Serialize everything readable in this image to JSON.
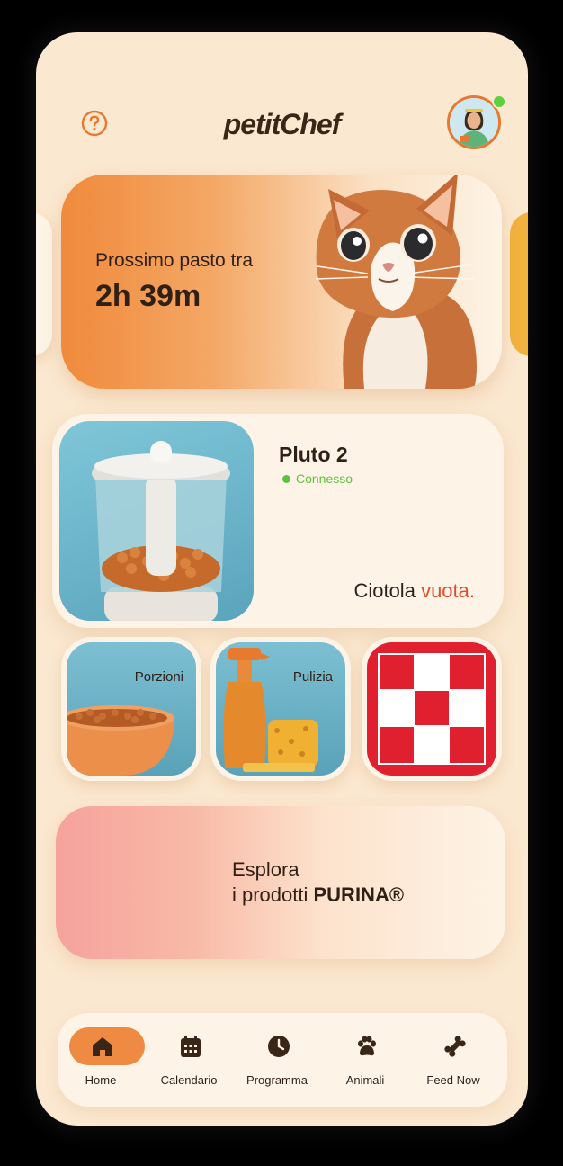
{
  "app": {
    "title": "petitChef"
  },
  "header": {
    "help_icon": "question-circle-icon",
    "avatar": "user-avatar"
  },
  "hero": {
    "label": "Prossimo pasto tra",
    "time": "2h 39m"
  },
  "device": {
    "name": "Pluto 2",
    "status": "Connesso",
    "bowl_text": "Ciotola",
    "bowl_state": "vuota."
  },
  "tiles": [
    {
      "label": "Porzioni"
    },
    {
      "label": "Pulizia"
    },
    {
      "label": ""
    }
  ],
  "promo": {
    "line1": "Esplora",
    "line2_prefix": "i prodotti ",
    "line2_brand": "PURINA®"
  },
  "tabs": [
    {
      "label": "Home",
      "icon": "home-icon",
      "active": true
    },
    {
      "label": "Calendario",
      "icon": "calendar-icon"
    },
    {
      "label": "Programma",
      "icon": "clock-icon"
    },
    {
      "label": "Animali",
      "icon": "paw-icon"
    },
    {
      "label": "Feed Now",
      "icon": "bone-icon"
    }
  ],
  "colors": {
    "background": "#fbe8d0",
    "accent": "#ef8a42",
    "connected": "#5fc23c",
    "alert": "#e5492d",
    "purina_red": "#e0202e"
  }
}
